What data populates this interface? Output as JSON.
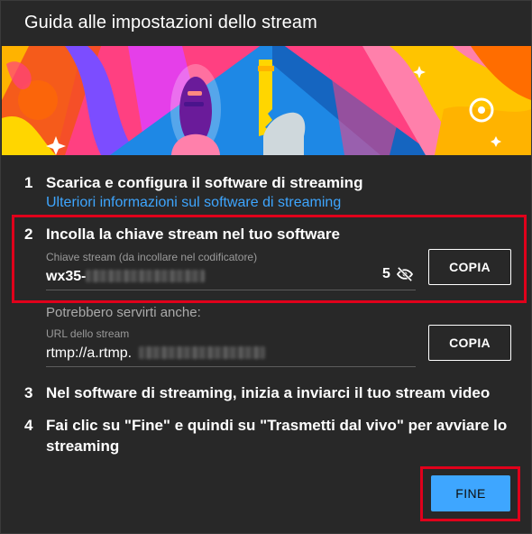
{
  "dialog": {
    "title": "Guida alle impostazioni dello stream"
  },
  "steps": [
    {
      "number": "1",
      "text": "Scarica e configura il software di streaming",
      "link": "Ulteriori informazioni sul software di streaming"
    },
    {
      "number": "2",
      "text": "Incolla la chiave stream nel tuo software"
    },
    {
      "number": "3",
      "text": "Nel software di streaming, inizia a inviarci il tuo stream video"
    },
    {
      "number": "4",
      "text_line1": "Fai clic su \"Fine\" e quindi su \"Trasmetti dal vivo\" per avviare lo",
      "text_line2": "streaming"
    }
  ],
  "stream_key": {
    "label": "Chiave stream (da incollare nel codificatore)",
    "value_visible": "wx35-",
    "char_count": "5",
    "copy_label": "COPIA",
    "visibility_icon": "eye-off-icon"
  },
  "extra": {
    "label": "Potrebbero servirti anche:"
  },
  "stream_url": {
    "label": "URL dello stream",
    "value_visible": "rtmp://a.rtmp.",
    "copy_label": "COPIA"
  },
  "footer": {
    "done_label": "FINE"
  },
  "colors": {
    "background": "#282828",
    "accent": "#3ea6ff",
    "highlight": "#e0001b"
  }
}
